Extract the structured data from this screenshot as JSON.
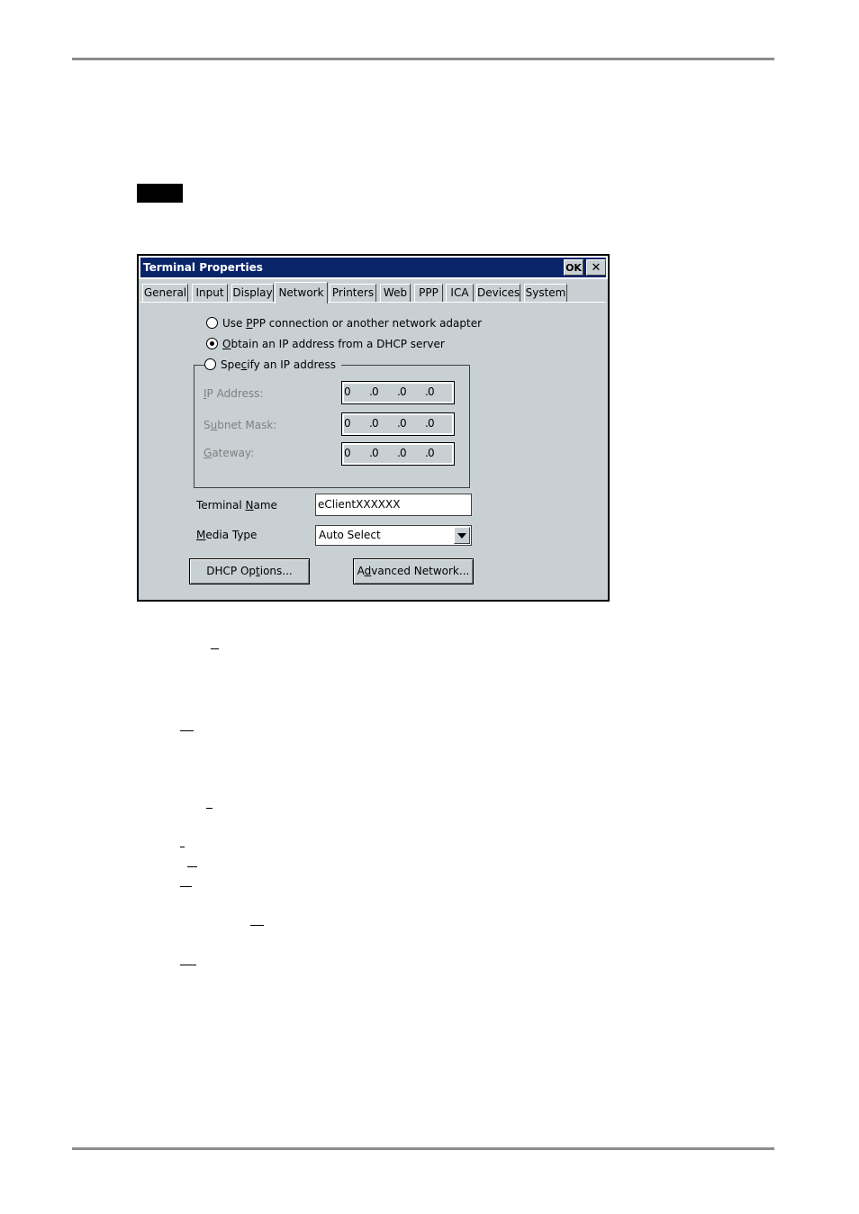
{
  "window": {
    "title": "Terminal Properties",
    "ok_label": "OK",
    "close_label": "✕"
  },
  "tabs": [
    {
      "label": "General"
    },
    {
      "label": "Input"
    },
    {
      "label": "Display"
    },
    {
      "label": "Network"
    },
    {
      "label": "Printers"
    },
    {
      "label": "Web"
    },
    {
      "label": "PPP"
    },
    {
      "label": "ICA"
    },
    {
      "label": "Devices"
    },
    {
      "label": "System"
    }
  ],
  "active_tab": "Network",
  "network": {
    "radio_ppp": {
      "pre": "Use ",
      "key": "P",
      "post": "PP connection or another network adapter",
      "checked": false
    },
    "radio_dhcp": {
      "pre": "",
      "key": "O",
      "post": "btain an IP address from a DHCP server",
      "checked": true
    },
    "radio_specify": {
      "pre": "Spe",
      "key": "c",
      "post": "ify an IP address",
      "checked": false
    },
    "ip_address": {
      "pre": "",
      "key": "I",
      "post": "P Address:",
      "octets": [
        "0",
        "0",
        "0",
        "0"
      ]
    },
    "subnet_mask": {
      "pre": "S",
      "key": "u",
      "post": "bnet Mask:",
      "octets": [
        "0",
        "0",
        "0",
        "0"
      ]
    },
    "gateway": {
      "pre": "",
      "key": "G",
      "post": "ateway:",
      "octets": [
        "0",
        "0",
        "0",
        "0"
      ]
    },
    "terminal_name": {
      "pre": "Terminal ",
      "key": "N",
      "post": "ame",
      "value": "eClientXXXXXX"
    },
    "media_type": {
      "pre": "",
      "key": "M",
      "post": "edia Type",
      "value": "Auto Select"
    },
    "dhcp_button": {
      "pre": "DHCP Op",
      "key": "t",
      "post": "ions..."
    },
    "advanced_button": {
      "pre": "A",
      "key": "d",
      "post": "vanced Network..."
    }
  },
  "colors": {
    "titlebar": "#0a246a",
    "dialog_face": "#c8d0d4",
    "disabled_text": "#808080"
  }
}
